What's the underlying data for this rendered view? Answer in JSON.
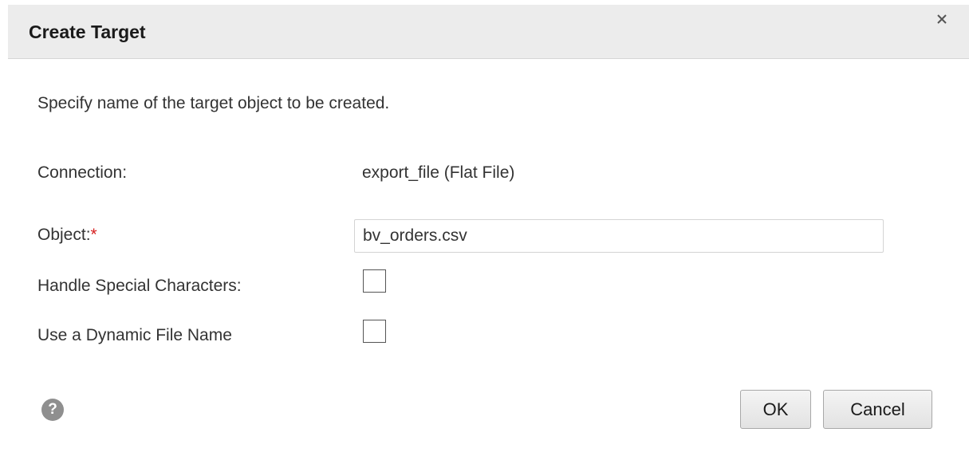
{
  "dialog": {
    "title": "Create Target",
    "close_icon": "close-icon",
    "description": "Specify name of the target object to be created."
  },
  "form": {
    "connection_label": "Connection:",
    "connection_value": "export_file (Flat File)",
    "object_label": "Object:",
    "object_required_marker": "*",
    "object_value": "bv_orders.csv",
    "handle_special_label": "Handle Special Characters:",
    "handle_special_checked": false,
    "dynamic_file_label": "Use a Dynamic File Name",
    "dynamic_file_checked": false
  },
  "footer": {
    "help_icon": "help-icon",
    "help_glyph": "?",
    "ok_label": "OK",
    "cancel_label": "Cancel"
  }
}
